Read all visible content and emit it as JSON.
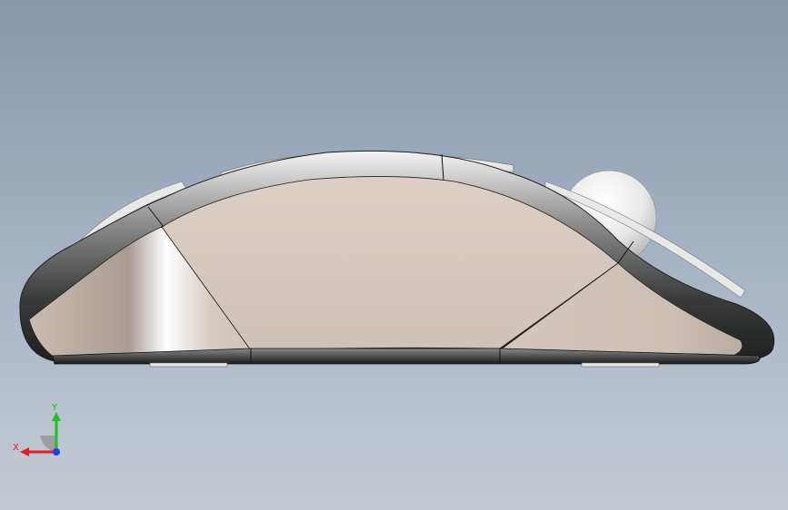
{
  "viewport": {
    "background_top": "#8897ab",
    "background_bottom": "#c4cbd5"
  },
  "model": {
    "body_color": "#d2c6bd",
    "rim_color": "#3e3f3f",
    "ball_color": "#eeeeee"
  },
  "triad": {
    "x_label": "X",
    "y_label": "Y",
    "x_color": "#e02020",
    "y_color": "#20c020",
    "z_color": "#2040e0"
  }
}
